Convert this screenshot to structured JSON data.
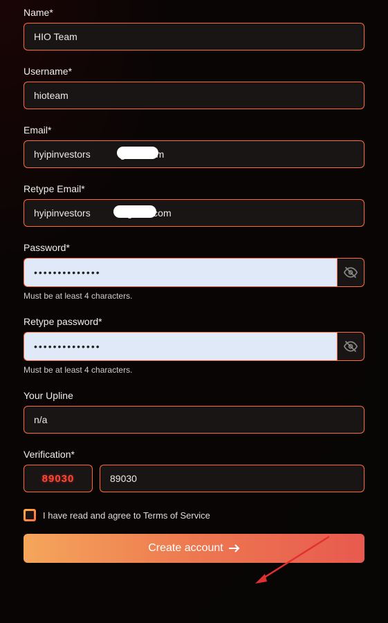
{
  "name": {
    "label": "Name*",
    "value": "HIO Team"
  },
  "username": {
    "label": "Username*",
    "value": "hioteam"
  },
  "email": {
    "label": "Email*",
    "value": "hyipinvestors           gmail.com"
  },
  "retype_email": {
    "label": "Retype Email*",
    "value": "hyipinvestors          @gmail.com"
  },
  "password": {
    "label": "Password*",
    "value": "••••••••••••••",
    "helper": "Must be at least 4 characters."
  },
  "retype_password": {
    "label": "Retype password*",
    "value": "••••••••••••••",
    "helper": "Must be at least 4 characters."
  },
  "upline": {
    "label": "Your Upline",
    "value": "n/a"
  },
  "verification": {
    "label": "Verification*",
    "captcha": "89030",
    "value": "89030"
  },
  "terms": {
    "text": "I have read and agree to ",
    "link": "Terms of Service"
  },
  "submit": {
    "label": "Create account"
  }
}
